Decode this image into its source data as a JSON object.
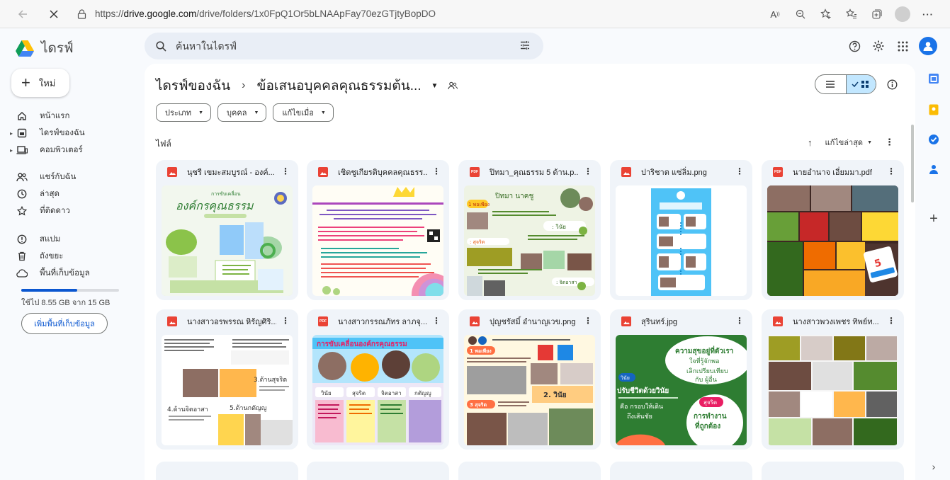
{
  "browser": {
    "url_prefix": "https://",
    "url_domain": "drive.google.com",
    "url_path": "/drive/folders/1x0FpQ1Or5bLNAApFay70ezGTjtyBopDO"
  },
  "header": {
    "app_name": "ไดรฟ์",
    "search_placeholder": "ค้นหาในไดรฟ์"
  },
  "sidebar": {
    "new_label": "ใหม่",
    "items": [
      {
        "label": "หน้าแรก",
        "icon": "home-icon"
      },
      {
        "label": "ไดรฟ์ของฉัน",
        "icon": "my-drive-icon"
      },
      {
        "label": "คอมพิวเตอร์",
        "icon": "computer-icon"
      },
      {
        "label": "แชร์กับฉัน",
        "icon": "shared-icon"
      },
      {
        "label": "ล่าสุด",
        "icon": "clock-icon"
      },
      {
        "label": "ที่ติดดาว",
        "icon": "star-icon"
      },
      {
        "label": "สแปม",
        "icon": "spam-icon"
      },
      {
        "label": "ถังขยะ",
        "icon": "trash-icon"
      },
      {
        "label": "พื้นที่เก็บข้อมูล",
        "icon": "cloud-icon"
      }
    ],
    "storage_used_fraction": 0.57,
    "storage_text": "ใช้ไป 8.55 GB จาก 15 GB",
    "more_storage_label": "เพิ่มพื้นที่เก็บข้อมูล"
  },
  "main": {
    "breadcrumb_root": "ไดรฟ์ของฉัน",
    "breadcrumb_current": "ข้อเสนอบุคคลคุณธรรมต้น...",
    "filters": [
      "ประเภท",
      "บุคคล",
      "แก้ไขเมื่อ"
    ],
    "files_label": "ไฟล์",
    "sort_label": "แก้ไขล่าสุด",
    "files": [
      {
        "name": "นุชรี เขมะสมบูรณ์ - องค์...",
        "type": "image"
      },
      {
        "name": "เชิดชูเกียรติบุคคลคุณธรร...",
        "type": "image"
      },
      {
        "name": "ปิทมา_คุณธรรม 5 ด้าน.p...",
        "type": "pdf"
      },
      {
        "name": "ปาริชาต แซ่ลิ่ม.png",
        "type": "image"
      },
      {
        "name": "นายอำนาจ เอี่ยมมา.pdf",
        "type": "pdf"
      },
      {
        "name": "นางสาวอรพรรณ หิรัญศิริ...",
        "type": "image"
      },
      {
        "name": "นางสาวกรรณภัทร ลาภจุ...",
        "type": "pdf"
      },
      {
        "name": "ปุญชรัสมิ์ อำนาญเวข.png",
        "type": "image"
      },
      {
        "name": "สุรินทร์.jpg",
        "type": "image"
      },
      {
        "name": "นางสาวพวงเพชร ทิพย์ท...",
        "type": "image"
      }
    ],
    "thumb_texts": {
      "t1_title": "องค์กรคุณธรรม",
      "t1_sub": "การขับเคลื่อน",
      "t3_name": "ปิทมา นาคชู",
      "t3_a": "1 พอเพียง",
      "t3_b": "2 วินัย",
      "t3_c": "3 สุจริต",
      "t3_d": "4 จิตอาสา",
      "t6_a": "3.ด้านสุจริต",
      "t6_b": "4.ด้านจิตอาสา",
      "t6_c": "5.ด้านกตัญญู",
      "t7_title": "การขับเคลื่อนองค์กรคุณธรรม",
      "t7_cols": [
        "วินัย",
        "สุจริต",
        "จิตอาสา",
        "กตัญญู"
      ],
      "t8_a": "1 พอเพียง",
      "t8_b": "2. วินัย",
      "t8_c": "3 สุจริต",
      "t9_a": "ความสุขอยู่ที่ตัวเรา",
      "t9_b": "ใจที่รู้จักพอ",
      "t9_c": "เลิกเปรียบเทียบ",
      "t9_d": "กับ ผู้อื่น",
      "t9_e": "ปรับชีวิตด้วยวินัย",
      "t9_f": "คือ กรอบให้เดิน",
      "t9_g": "ถึงเส้นชัย",
      "t9_h": "การทำงาน",
      "t9_i": "ที่ถูกต้อง",
      "t9_j": "วินัย",
      "t9_k": "สุจริต",
      "t5_badge": "5",
      "t5_badge_sub": "คุณธรรม"
    }
  },
  "colors": {
    "accent": "#0b57d0",
    "drive_blue": "#4285f4",
    "drive_green": "#0f9d58",
    "drive_yellow": "#ffc107",
    "file_red": "#ea4335"
  }
}
